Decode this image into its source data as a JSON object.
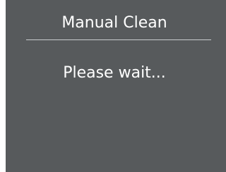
{
  "screen": {
    "title": "Manual Clean",
    "message": "Please wait..."
  },
  "colors": {
    "background": "#575a5c",
    "text": "#ffffff",
    "divider": "#c8cbcd"
  }
}
